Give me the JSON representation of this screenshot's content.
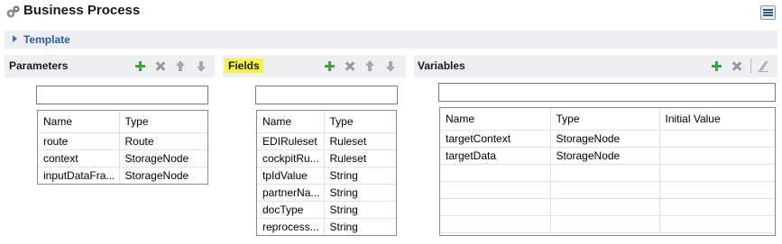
{
  "header": {
    "title": "Business Process",
    "app_icon": "gears-icon",
    "toggle_icon": "layout-toggle-icon"
  },
  "template": {
    "label": "Template",
    "expanded": false
  },
  "parameters": {
    "title": "Parameters",
    "filter_value": "",
    "columns": [
      "Name",
      "Type"
    ],
    "rows": [
      [
        "route",
        "Route"
      ],
      [
        "context",
        "StorageNode"
      ],
      [
        "inputDataFra...",
        "StorageNode"
      ]
    ]
  },
  "fields": {
    "title": "Fields",
    "highlight_color": "#f6f43e",
    "filter_value": "",
    "columns": [
      "Name",
      "Type"
    ],
    "rows": [
      [
        "EDIRuleset",
        "Ruleset"
      ],
      [
        "cockpitRu...",
        "Ruleset"
      ],
      [
        "tpIdValue",
        "String"
      ],
      [
        "partnerNa...",
        "String"
      ],
      [
        "docType",
        "String"
      ],
      [
        "reprocess...",
        "String"
      ]
    ]
  },
  "variables": {
    "title": "Variables",
    "filter_value": "",
    "columns": [
      "Name",
      "Type",
      "Initial Value"
    ],
    "rows": [
      [
        "targetContext",
        "StorageNode",
        ""
      ],
      [
        "targetData",
        "StorageNode",
        ""
      ],
      [
        "",
        "",
        ""
      ],
      [
        "",
        "",
        ""
      ],
      [
        "",
        "",
        ""
      ],
      [
        "",
        "",
        ""
      ]
    ]
  },
  "colors": {
    "section_bg": "#edeff2",
    "template_link": "#2b5ea8",
    "add_icon": "#3fa33f"
  }
}
